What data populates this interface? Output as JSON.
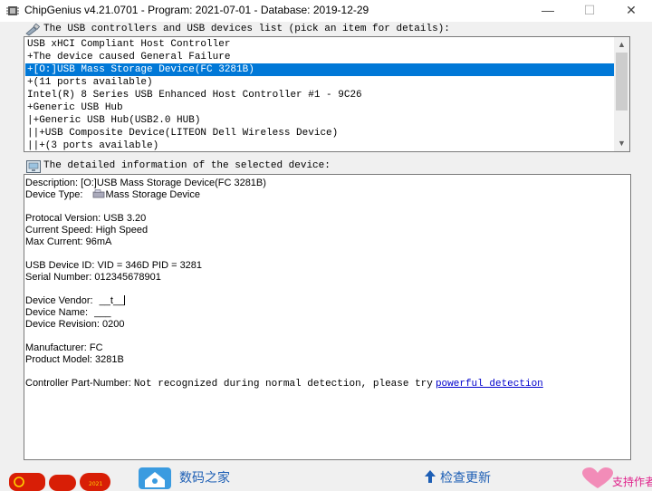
{
  "window": {
    "title": "ChipGenius v4.21.0701 - Program: 2021-07-01 - Database: 2019-12-29",
    "minimize": "—",
    "maximize": "☐",
    "close": "✕"
  },
  "device_list": {
    "label": "The USB controllers and USB devices list (pick an item for details):",
    "items": [
      "USB xHCI Compliant Host Controller",
      "+The device caused General Failure",
      "+[O:]USB Mass Storage Device(FC 3281B)",
      "+(11 ports available)",
      "Intel(R) 8 Series USB Enhanced Host Controller #1 - 9C26",
      "+Generic USB Hub",
      "|+Generic USB Hub(USB2.0 HUB)",
      "||+USB Composite Device(LITEON Dell Wireless Device)",
      "||+(3 ports available)"
    ],
    "selected_index": 2,
    "scroll_up": "▲",
    "scroll_down": "▼"
  },
  "details": {
    "label": "The detailed information of the selected device:",
    "description": "Description: [O:]USB Mass Storage Device(FC 3281B)",
    "device_type_label": "Device Type:",
    "device_type_value": "Mass Storage Device",
    "protocol_version": "Protocal Version: USB 3.20",
    "current_speed": "Current Speed: High Speed",
    "max_current": "Max Current: 96mA",
    "usb_device_id": "USB Device ID: VID = 346D PID = 3281",
    "serial_number": "Serial Number: 012345678901",
    "vendor_label": "Device Vendor:",
    "vendor_value": "__t__",
    "name_label": "Device Name:",
    "name_value": "___",
    "revision": "Device Revision: 0200",
    "manufacturer": "Manufacturer: FC",
    "product_model": "Product Model: 3281B",
    "controller_label": "Controller Part-Number:",
    "controller_text": "Not recognized during normal detection, please try",
    "controller_link": "powerful detection"
  },
  "footer": {
    "brand": "数码之家",
    "update": "检查更新",
    "support": "支持作者"
  },
  "colors": {
    "selection": "#0078d7",
    "link": "#0000cc",
    "brand_blue": "#1e5fb5",
    "support_pink": "#e0208a"
  }
}
